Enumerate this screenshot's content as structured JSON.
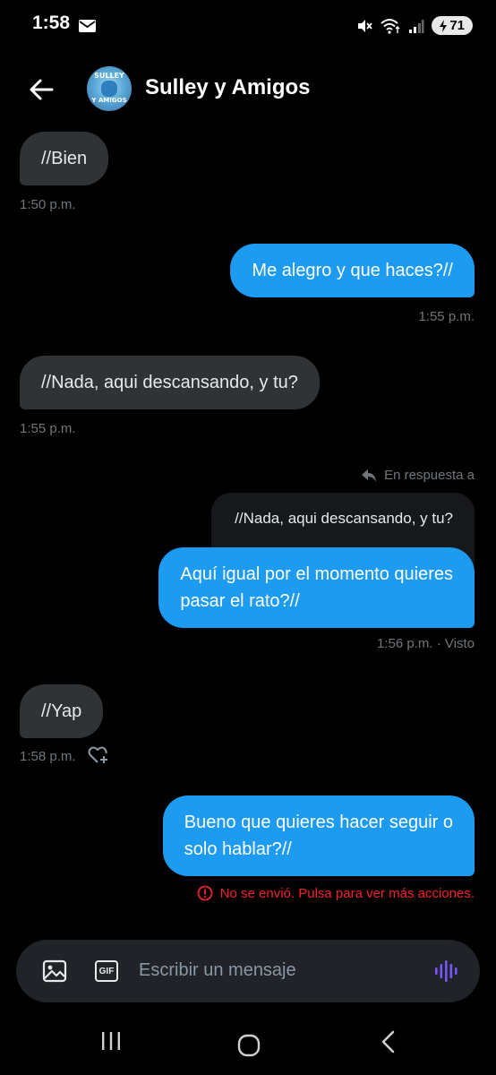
{
  "status_bar": {
    "time": "1:58",
    "battery": "71"
  },
  "header": {
    "title": "Sulley y Amigos",
    "avatar_text_top": "SULLEY",
    "avatar_text_bottom": "Y AMIGOS"
  },
  "messages": [
    {
      "dir": "in",
      "text": "//Bien",
      "time": "1:50 p.m."
    },
    {
      "dir": "out",
      "text": "Me alegro y que haces?//",
      "time": "1:55 p.m."
    },
    {
      "dir": "in",
      "text": "//Nada, aqui descansando, y tu?",
      "time": "1:55 p.m."
    },
    {
      "dir": "out",
      "reply_label": "En respuesta a",
      "quoted": "//Nada, aqui descansando, y tu?",
      "text_line1": "Aquí igual por el momento quieres",
      "text_line2": "pasar el rato?//",
      "time": "1:56 p.m. · Visto"
    },
    {
      "dir": "in",
      "text": "//Yap",
      "time": "1:58 p.m."
    },
    {
      "dir": "out",
      "text_line1": "Bueno que quieres hacer seguir o",
      "text_line2": "solo hablar?//",
      "error": "No se envió. Pulsa para ver más acciones."
    }
  ],
  "composer": {
    "placeholder": "Escribir un mensaje",
    "gif_label": "GIF"
  },
  "colors": {
    "background": "#000000",
    "incoming_bubble": "#2f3336",
    "outgoing_bubble": "#1d9bf0",
    "error": "#f4212e",
    "voice_accent": "#7856ff"
  }
}
